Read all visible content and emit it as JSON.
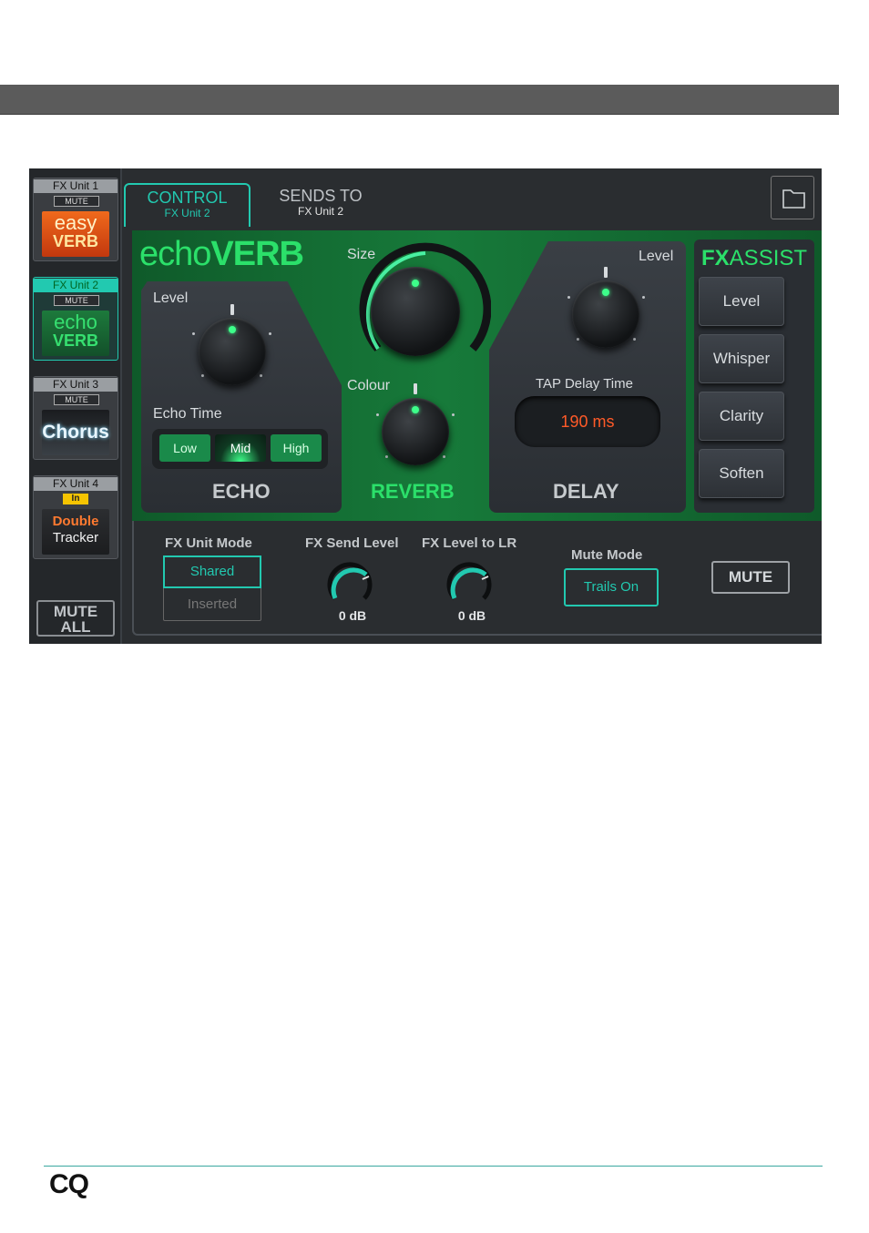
{
  "fx_units": [
    {
      "label": "FX Unit 1",
      "badge": "MUTE",
      "art_line1": "easy",
      "art_line2": "VERB"
    },
    {
      "label": "FX Unit 2",
      "badge": "MUTE",
      "art_line1": "echo",
      "art_line2": "VERB",
      "selected": true
    },
    {
      "label": "FX Unit 3",
      "badge": "MUTE",
      "art_line1": "Chorus",
      "art_line2": ""
    },
    {
      "label": "FX Unit 4",
      "badge": "In",
      "art_line1": "Double",
      "art_line2": "Tracker"
    }
  ],
  "mute_all": {
    "line1": "MUTE",
    "line2": "ALL"
  },
  "tabs": [
    {
      "label": "CONTROL",
      "sub": "FX Unit 2",
      "active": true
    },
    {
      "label": "SENDS TO",
      "sub": "FX Unit 2",
      "active": false
    }
  ],
  "brand": {
    "light": "echo",
    "bold": "VERB"
  },
  "echo": {
    "level_label": "Level",
    "echo_time_label": "Echo Time",
    "options": [
      "Low",
      "Mid",
      "High"
    ],
    "selected": "Mid",
    "title": "ECHO"
  },
  "reverb": {
    "size_label": "Size",
    "colour_label": "Colour",
    "title": "REVERB"
  },
  "delay": {
    "level_label": "Level",
    "tap_label": "TAP Delay Time",
    "tap_value": "190 ms",
    "title": "DELAY"
  },
  "fx_assist": {
    "title_bold": "FX",
    "title_light": "ASSIST",
    "buttons": [
      "Level",
      "Whisper",
      "Clarity",
      "Soften"
    ]
  },
  "bottom": {
    "fx_unit_mode_label": "FX Unit Mode",
    "mode_shared": "Shared",
    "mode_inserted": "Inserted",
    "fx_send_level_label": "FX Send Level",
    "fx_send_level_value": "0 dB",
    "fx_level_lr_label": "FX Level to LR",
    "fx_level_lr_value": "0 dB",
    "mute_mode_label": "Mute Mode",
    "mute_mode_value": "Trails On",
    "mute_label": "MUTE"
  },
  "footer": {
    "logo": "CQ"
  },
  "colors": {
    "accent": "#22c9b0",
    "brand_green": "#2be06a",
    "panel_green": "#177a3a",
    "delay_value": "#ff5a28",
    "in_badge": "#f5c400"
  }
}
